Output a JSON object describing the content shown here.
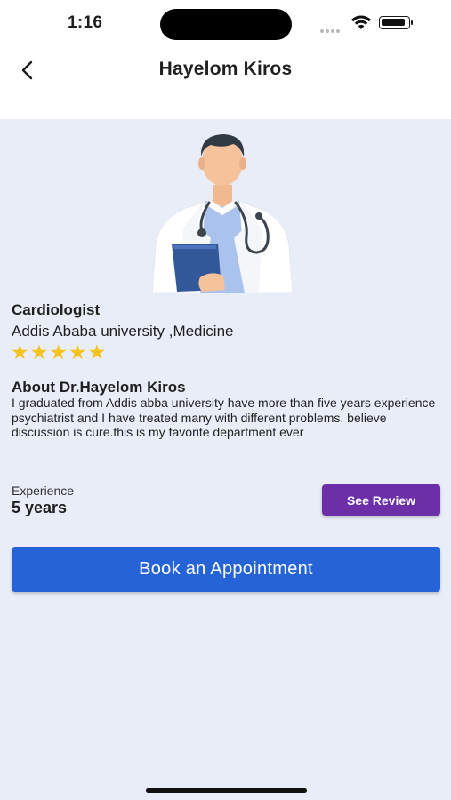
{
  "status_bar": {
    "time": "1:16",
    "icons": [
      "cellular-icon",
      "wifi-icon",
      "battery-icon"
    ]
  },
  "header": {
    "back_icon": "chevron-left-icon",
    "title": "Hayelom Kiros"
  },
  "profile": {
    "avatar_icon": "doctor-illustration",
    "specialty": "Cardiologist",
    "education": "Addis Ababa university ,Medicine",
    "rating": 5,
    "rating_max": 5,
    "star_color": "#f6c21c"
  },
  "about": {
    "title": "About Dr.Hayelom Kiros",
    "text": "I graduated from Addis abba university have more than five years experience psychiatrist and I have treated many with different problems. believe discussion is cure.this is my favorite department ever"
  },
  "experience": {
    "label": "Experience",
    "value": "5 years"
  },
  "actions": {
    "see_review_label": "See Review",
    "see_review_color": "#6d2fa8",
    "book_label": "Book an Appointment",
    "book_color": "#2563d6"
  },
  "colors": {
    "background": "#e8edf8",
    "header_background": "#ffffff"
  }
}
